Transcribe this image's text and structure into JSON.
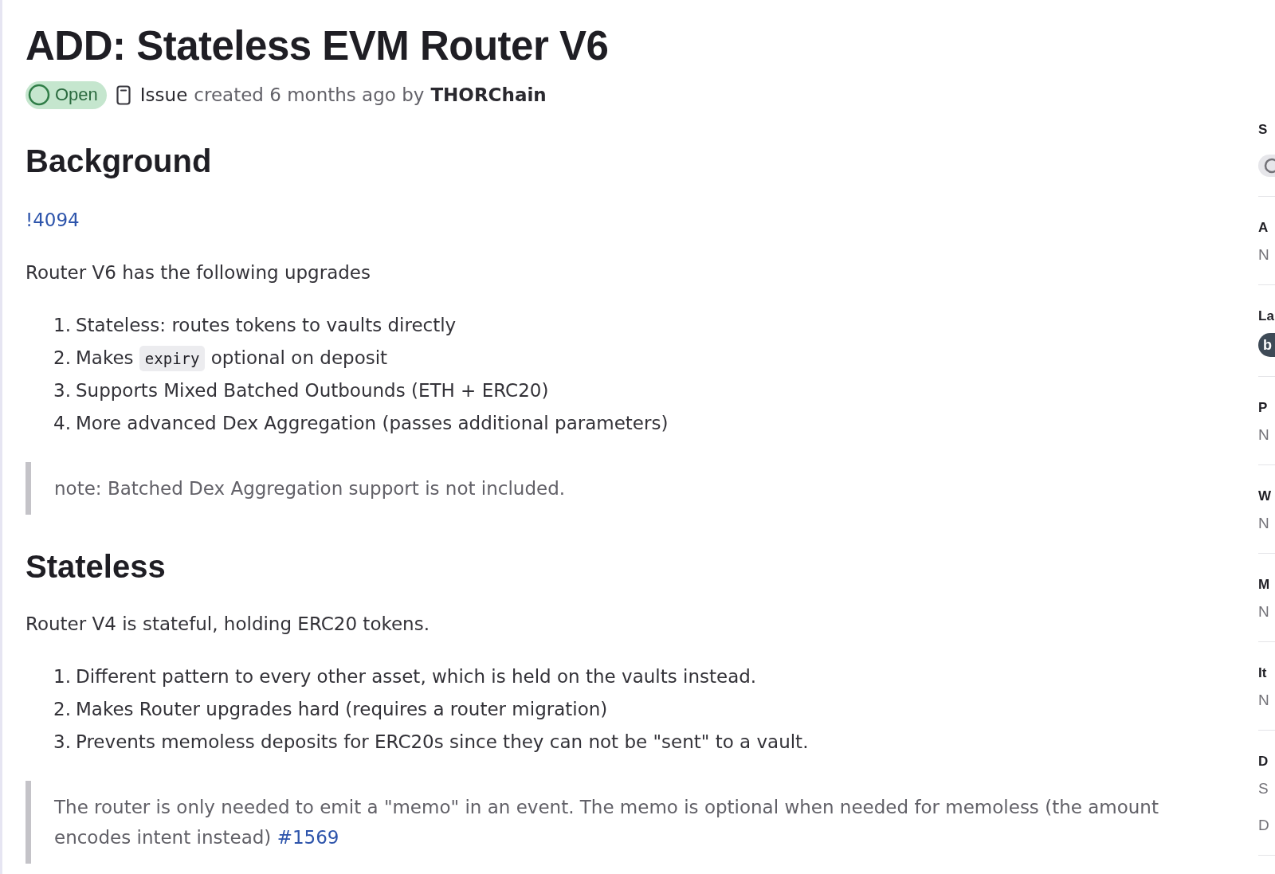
{
  "issue": {
    "title": "ADD: Stateless EVM Router V6",
    "status": {
      "label": "Open"
    },
    "meta": {
      "type": "Issue",
      "created": "created 6 months ago by",
      "author": "THORChain"
    }
  },
  "description": [
    {
      "kind": "heading",
      "text": "Background"
    },
    {
      "kind": "link",
      "text": "!4094"
    },
    {
      "kind": "paragraph",
      "text": "Router V6 has the following upgrades"
    },
    {
      "kind": "list",
      "items": [
        {
          "number": "1.",
          "parts": [
            {
              "kind": "text",
              "text": "Stateless: routes tokens to vaults directly"
            }
          ]
        },
        {
          "number": "2.",
          "parts": [
            {
              "kind": "text",
              "text": "Makes"
            },
            {
              "kind": "code",
              "text": "expiry"
            },
            {
              "kind": "text",
              "text": "optional on deposit"
            }
          ]
        },
        {
          "number": "3.",
          "parts": [
            {
              "kind": "text",
              "text": "Supports Mixed Batched Outbounds (ETH + ERC20)"
            }
          ]
        },
        {
          "number": "4.",
          "parts": [
            {
              "kind": "text",
              "text": "More advanced Dex Aggregation (passes additional parameters)"
            }
          ]
        }
      ]
    },
    {
      "kind": "quote",
      "text": "note: Batched Dex Aggregation support is not included."
    },
    {
      "kind": "heading",
      "text": "Stateless"
    },
    {
      "kind": "paragraph",
      "text": "Router V4 is stateful, holding ERC20 tokens."
    },
    {
      "kind": "list",
      "items": [
        {
          "number": "1.",
          "parts": [
            {
              "kind": "text",
              "text": "Different pattern to every other asset, which is held on the vaults instead."
            }
          ]
        },
        {
          "number": "2.",
          "parts": [
            {
              "kind": "text",
              "text": "Makes Router upgrades hard (requires a router migration)"
            }
          ]
        },
        {
          "number": "3.",
          "parts": [
            {
              "kind": "text",
              "text": "Prevents memoless deposits for ERC20s since they can not be \"sent\" to a vault."
            }
          ]
        }
      ]
    },
    {
      "kind": "quote",
      "text": "The router is only needed to emit a \"memo\" in an event. The memo is optional when needed for memoless (the amount encodes intent instead)",
      "link": "#1569"
    }
  ],
  "sidebar": [
    {
      "kind": "status",
      "label": "S"
    },
    {
      "kind": "text",
      "label": "A",
      "values": [
        "N"
      ]
    },
    {
      "kind": "badge",
      "label": "La",
      "badge": "b"
    },
    {
      "kind": "text",
      "label": "P",
      "values": [
        "N"
      ]
    },
    {
      "kind": "text",
      "label": "W",
      "values": [
        "N"
      ]
    },
    {
      "kind": "text",
      "label": "M",
      "values": [
        "N"
      ]
    },
    {
      "kind": "text",
      "label": "It",
      "values": [
        "N"
      ]
    },
    {
      "kind": "text",
      "label": "D",
      "values": [
        "S",
        "D"
      ]
    }
  ]
}
